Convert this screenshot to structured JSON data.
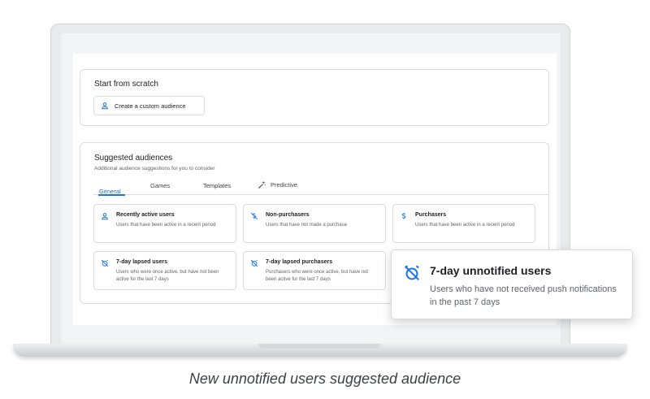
{
  "scratch": {
    "title": "Start from scratch",
    "create_button": "Create a custom audience"
  },
  "suggested": {
    "title": "Suggested audiences",
    "subtitle": "Additional audience suggestions for you to consider",
    "tabs": [
      {
        "label": "General",
        "active": true
      },
      {
        "label": "Games",
        "active": false
      },
      {
        "label": "Templates",
        "active": false
      },
      {
        "label": "Predictive",
        "active": false
      }
    ],
    "cards": [
      {
        "title": "Recently active users",
        "desc": "Users that have been active in a recent period",
        "icon": "person-icon"
      },
      {
        "title": "Non-purchasers",
        "desc": "Users that have not made a purchase",
        "icon": "no-dollar-icon"
      },
      {
        "title": "Purchasers",
        "desc": "Users that have been active in a recent period",
        "icon": "dollar-icon"
      },
      {
        "title": "7-day lapsed users",
        "desc": "Users who were once active, but have not been active for the last 7 days",
        "icon": "alarm-off-icon"
      },
      {
        "title": "7-day lapsed purchasers",
        "desc": "Purchasers who were once active, but have not been active for the last 7 days",
        "icon": "alarm-off-icon"
      }
    ]
  },
  "popup": {
    "title": "7-day unnotified users",
    "desc": "Users who have not received push notifications in the past 7 days",
    "icon": "alarm-off-icon"
  },
  "caption": "New unnotified users suggested audience",
  "colors": {
    "accent": "#1a73e8",
    "border": "#dadce0",
    "text_secondary": "#5f6368"
  }
}
